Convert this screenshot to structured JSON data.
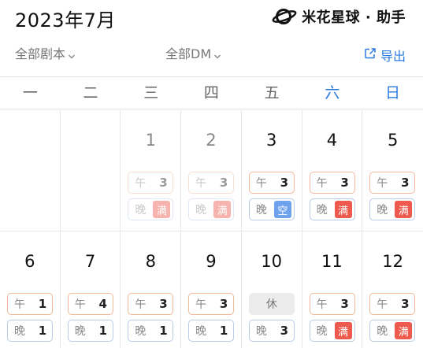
{
  "header": {
    "month_title": "2023年7月",
    "brand": "米花星球 · 助手"
  },
  "filters": {
    "script": "全部剧本",
    "dm": "全部DM",
    "export": "导出"
  },
  "weekdays": [
    "一",
    "二",
    "三",
    "四",
    "五",
    "六",
    "日"
  ],
  "calendar": {
    "weeks": [
      {
        "days": [
          {
            "empty": true
          },
          {
            "empty": true
          },
          {
            "day": "1",
            "past": true,
            "noon": {
              "label": "午",
              "value": "3"
            },
            "night": {
              "label": "晚",
              "value": "满",
              "status": "full"
            }
          },
          {
            "day": "2",
            "past": true,
            "noon": {
              "label": "午",
              "value": "3"
            },
            "night": {
              "label": "晚",
              "value": "满",
              "status": "full"
            }
          },
          {
            "day": "3",
            "noon": {
              "label": "午",
              "value": "3"
            },
            "night": {
              "label": "晚",
              "value": "空",
              "status": "free"
            }
          },
          {
            "day": "4",
            "noon": {
              "label": "午",
              "value": "3"
            },
            "night": {
              "label": "晚",
              "value": "满",
              "status": "full"
            }
          },
          {
            "day": "5",
            "noon": {
              "label": "午",
              "value": "3"
            },
            "night": {
              "label": "晚",
              "value": "满",
              "status": "full"
            }
          }
        ]
      },
      {
        "days": [
          {
            "day": "6",
            "noon": {
              "label": "午",
              "value": "1"
            },
            "night": {
              "label": "晚",
              "value": "1"
            }
          },
          {
            "day": "7",
            "noon": {
              "label": "午",
              "value": "4"
            },
            "night": {
              "label": "晚",
              "value": "1"
            }
          },
          {
            "day": "8",
            "noon": {
              "label": "午",
              "value": "3"
            },
            "night": {
              "label": "晚",
              "value": "1"
            }
          },
          {
            "day": "9",
            "noon": {
              "label": "午",
              "value": "3"
            },
            "night": {
              "label": "晚",
              "value": "1"
            }
          },
          {
            "day": "10",
            "rest": "休",
            "night": {
              "label": "晚",
              "value": "3"
            }
          },
          {
            "day": "11",
            "noon": {
              "label": "午",
              "value": "3"
            },
            "night": {
              "label": "晚",
              "value": "满",
              "status": "full"
            }
          },
          {
            "day": "12",
            "noon": {
              "label": "午",
              "value": "3"
            },
            "night": {
              "label": "晚",
              "value": "满",
              "status": "full"
            }
          }
        ]
      }
    ]
  },
  "colors": {
    "accent": "#2a7ae2",
    "full": "#ee5a4d",
    "free": "#6fa2ec",
    "noon_border": "#f2b998",
    "night_border": "#b8cbe8"
  }
}
